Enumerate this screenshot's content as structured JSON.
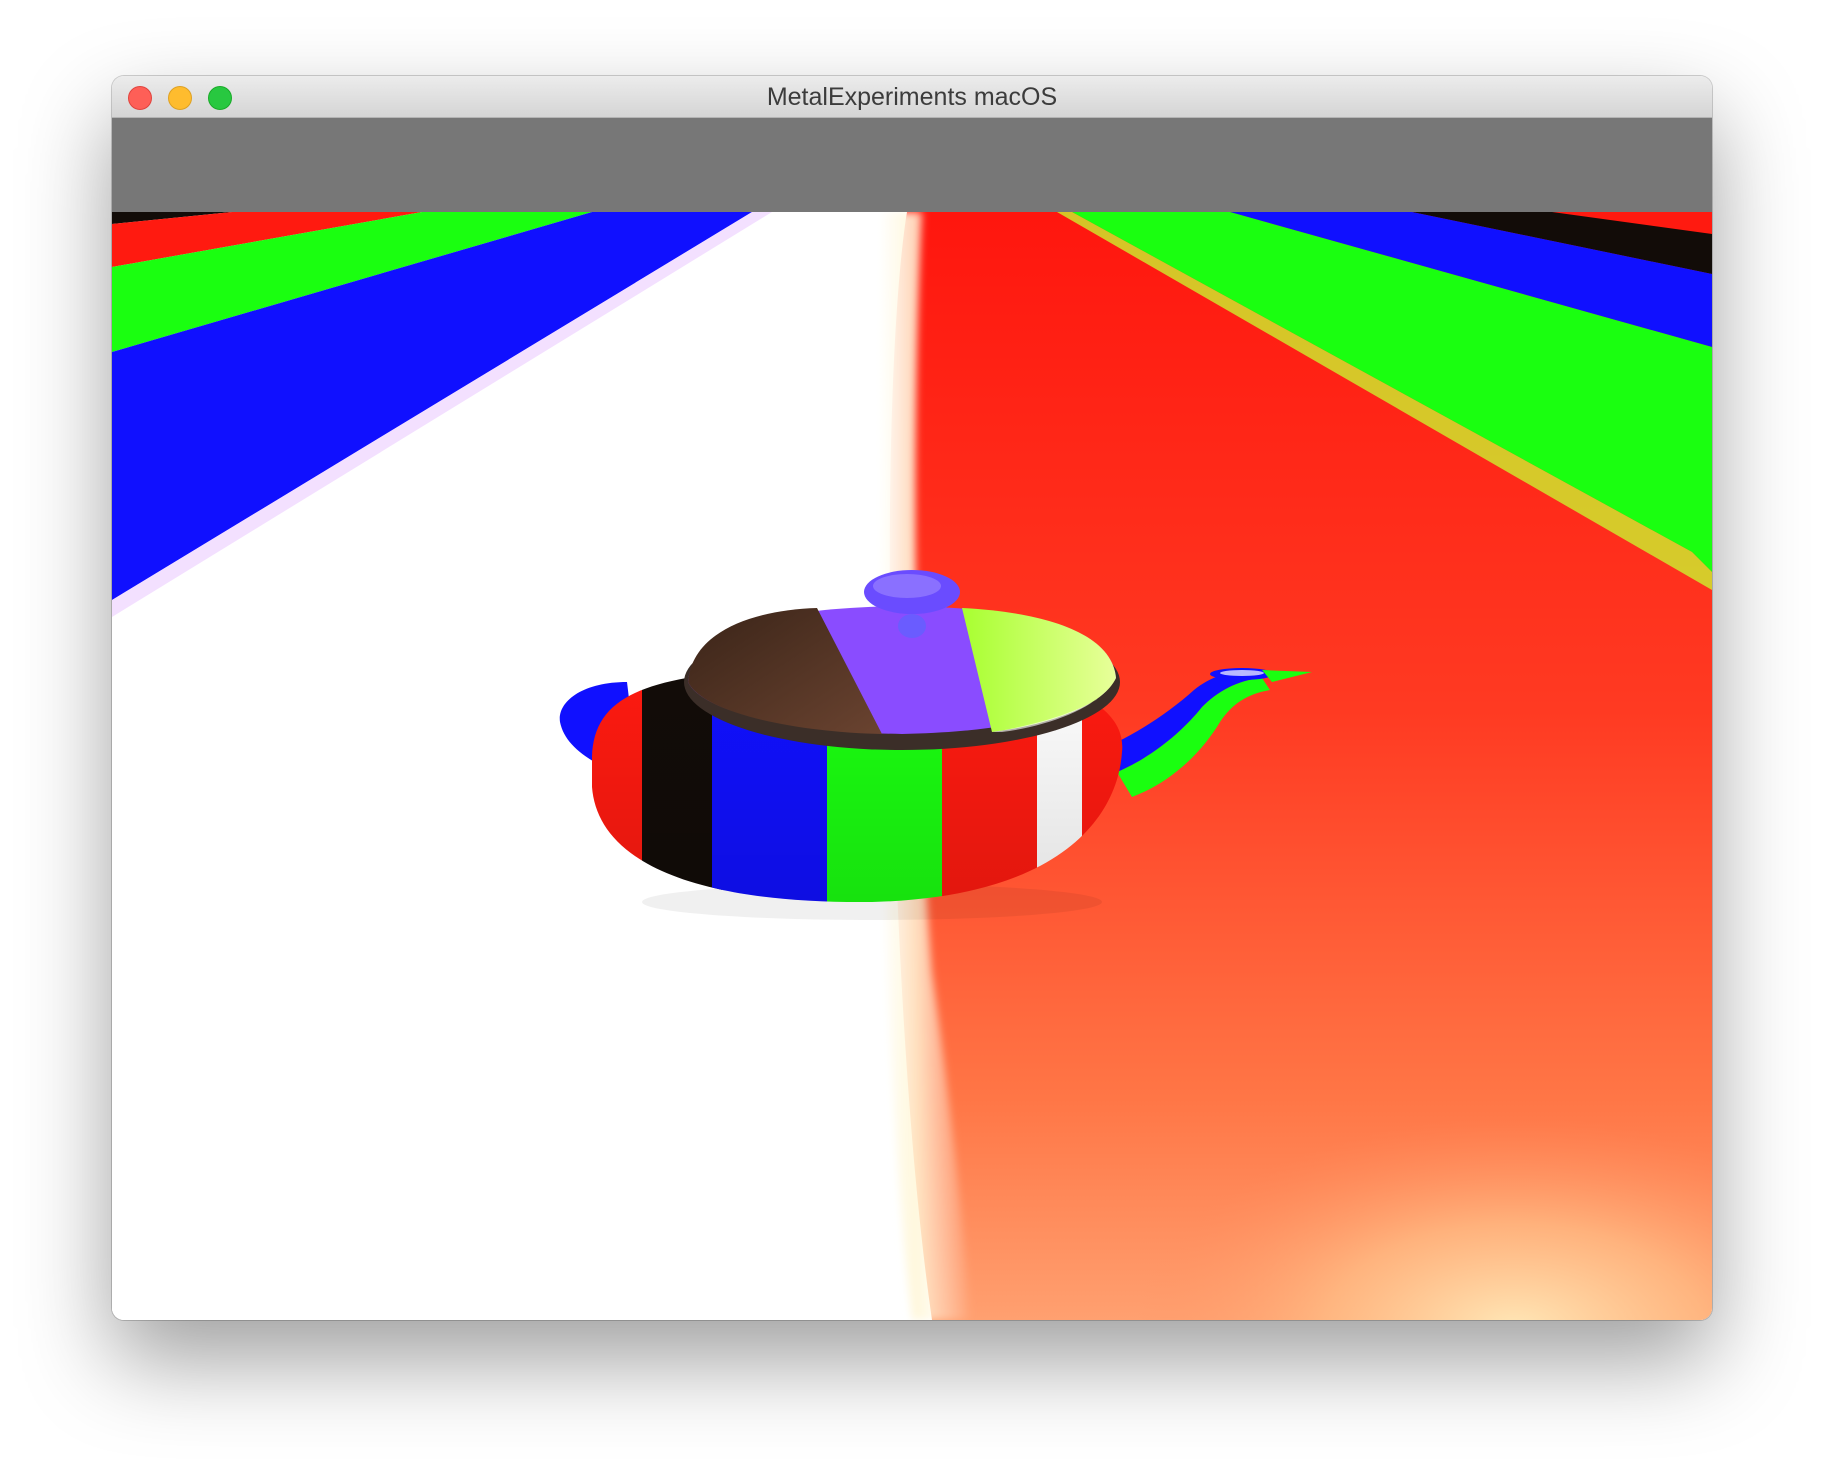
{
  "window": {
    "title": "MetalExperiments macOS",
    "controls": {
      "close": "close-button",
      "minimize": "minimize-button",
      "zoom": "zoom-button"
    }
  },
  "colors": {
    "close": "#fe5f57",
    "minimize": "#febc2e",
    "zoom": "#28c840",
    "toolbar_band": "#777777",
    "stripe_red": "#ff1a10",
    "stripe_green": "#1aff10",
    "stripe_blue": "#1010ff",
    "stripe_black": "#120c08",
    "floor_white": "#ffffff",
    "floor_red_orange": "#ff3a20"
  },
  "scene": {
    "object": "teapot",
    "render": "striped-rgb-lighting"
  }
}
